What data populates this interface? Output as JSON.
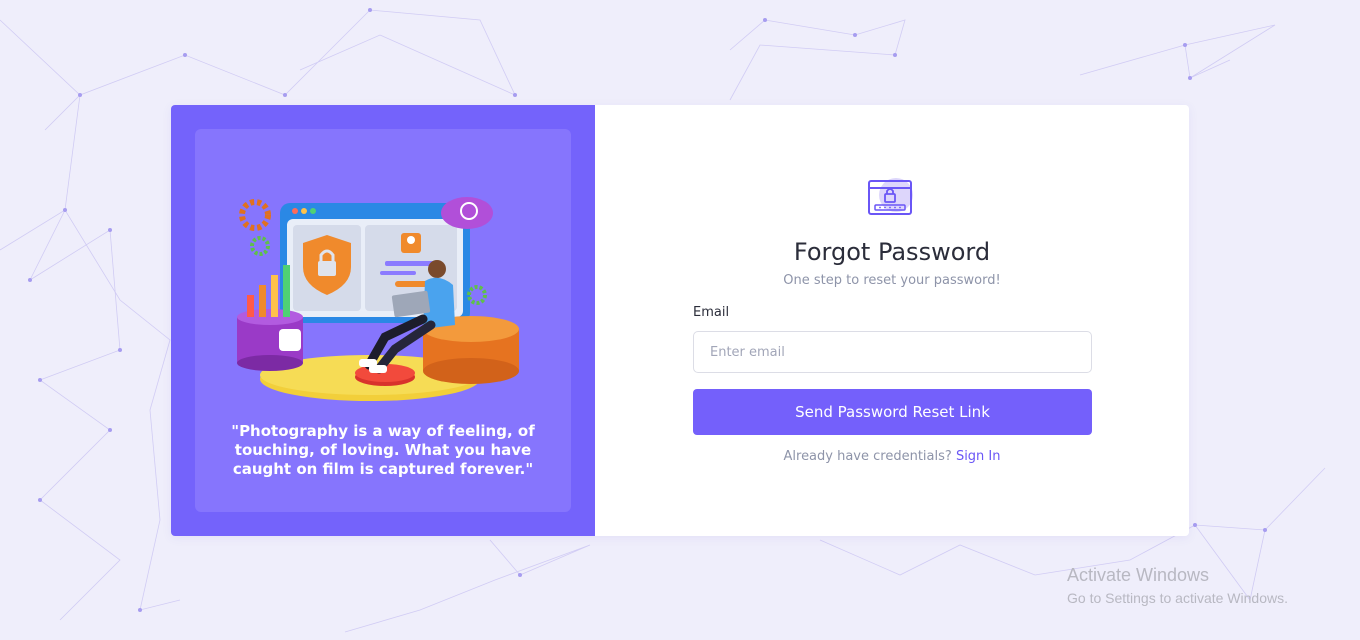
{
  "quote": "\"Photography is a way of feeling, of touching, of loving. What you have caught on film is captured forever.\"",
  "form": {
    "title": "Forgot Password",
    "subtitle": "One step to reset your password!",
    "email_label": "Email",
    "email_placeholder": "Enter email",
    "email_value": "",
    "submit_label": "Send Password Reset Link",
    "signin_prompt": "Already have credentials?",
    "signin_link": "Sign In"
  },
  "watermark": {
    "title": "Activate Windows",
    "subtitle": "Go to Settings to activate Windows."
  },
  "colors": {
    "accent": "#7460fb",
    "left_panel": "#7463fb",
    "background": "#efeefb"
  },
  "icons": [
    "password-lock-icon",
    "security-illustration"
  ]
}
